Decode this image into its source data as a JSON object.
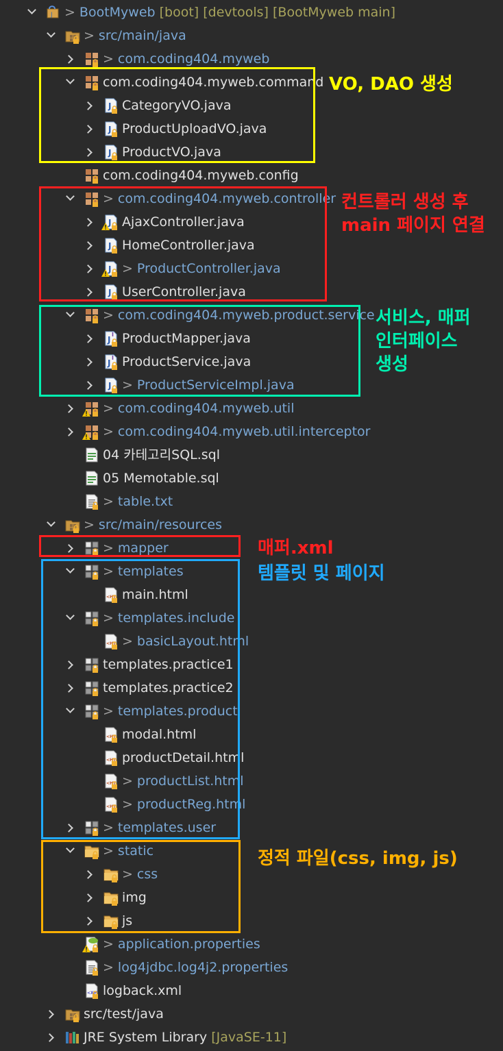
{
  "tree": [
    {
      "depth": 0,
      "chev": "e",
      "icon": "project",
      "dirty": true,
      "text": "BootMyweb",
      "suffix": " [boot] [devtools] [BootMyweb main]",
      "color": "blue",
      "x": 36
    },
    {
      "depth": 1,
      "chev": "e",
      "icon": "srcfolder",
      "dirty": true,
      "text": "src/main/java",
      "color": "blue"
    },
    {
      "depth": 2,
      "chev": "c",
      "icon": "package",
      "dirty": true,
      "text": "com.coding404.myweb",
      "color": "blue"
    },
    {
      "depth": 2,
      "chev": "e",
      "icon": "package",
      "text": "com.coding404.myweb.command",
      "color": "white"
    },
    {
      "depth": 3,
      "chev": "c",
      "icon": "java",
      "text": "CategoryVO.java",
      "color": "white"
    },
    {
      "depth": 3,
      "chev": "c",
      "icon": "java",
      "text": "ProductUploadVO.java",
      "color": "white"
    },
    {
      "depth": 3,
      "chev": "c",
      "icon": "java",
      "text": "ProductVO.java",
      "color": "white"
    },
    {
      "depth": 2,
      "chev": "",
      "icon": "package",
      "text": "com.coding404.myweb.config",
      "color": "white"
    },
    {
      "depth": 2,
      "chev": "e",
      "icon": "package",
      "dirty": true,
      "text": "com.coding404.myweb.controller",
      "color": "blue"
    },
    {
      "depth": 3,
      "chev": "c",
      "icon": "java",
      "warn": true,
      "text": "AjaxController.java",
      "color": "white"
    },
    {
      "depth": 3,
      "chev": "c",
      "icon": "java",
      "text": "HomeController.java",
      "color": "white"
    },
    {
      "depth": 3,
      "chev": "c",
      "icon": "java",
      "warn": true,
      "dirty": true,
      "text": "ProductController.java",
      "color": "blue"
    },
    {
      "depth": 3,
      "chev": "c",
      "icon": "java",
      "text": "UserController.java",
      "color": "white"
    },
    {
      "depth": 2,
      "chev": "e",
      "icon": "package",
      "dirty": true,
      "text": "com.coding404.myweb.product.service",
      "color": "blue"
    },
    {
      "depth": 3,
      "chev": "c",
      "icon": "interface",
      "text": "ProductMapper.java",
      "color": "white"
    },
    {
      "depth": 3,
      "chev": "c",
      "icon": "interface",
      "text": "ProductService.java",
      "color": "white"
    },
    {
      "depth": 3,
      "chev": "c",
      "icon": "java",
      "dirty": true,
      "text": "ProductServiceImpl.java",
      "color": "blue"
    },
    {
      "depth": 2,
      "chev": "c",
      "icon": "package",
      "warn": true,
      "dirty": true,
      "text": "com.coding404.myweb.util",
      "color": "blue"
    },
    {
      "depth": 2,
      "chev": "c",
      "icon": "package",
      "warn": true,
      "dirty": true,
      "text": "com.coding404.myweb.util.interceptor",
      "color": "blue"
    },
    {
      "depth": 2,
      "chev": "",
      "icon": "sql",
      "text": "04 카테고리SQL.sql",
      "color": "white"
    },
    {
      "depth": 2,
      "chev": "",
      "icon": "sql",
      "text": "05 Memotable.sql",
      "color": "white"
    },
    {
      "depth": 2,
      "chev": "",
      "icon": "text",
      "dirty": true,
      "text": "table.txt",
      "color": "blue"
    },
    {
      "depth": 1,
      "chev": "e",
      "icon": "srcfolder",
      "dirty": true,
      "text": "src/main/resources",
      "color": "blue"
    },
    {
      "depth": 2,
      "chev": "c",
      "icon": "folderpkg",
      "dirty": true,
      "text": "mapper",
      "color": "blue"
    },
    {
      "depth": 2,
      "chev": "e",
      "icon": "folderpkg",
      "dirty": true,
      "text": "templates",
      "color": "blue"
    },
    {
      "depth": 3,
      "chev": "",
      "icon": "html",
      "text": "main.html",
      "color": "white"
    },
    {
      "depth": 2,
      "chev": "e",
      "icon": "folderpkg",
      "dirty": true,
      "text": "templates.include",
      "color": "blue"
    },
    {
      "depth": 3,
      "chev": "",
      "icon": "html",
      "dirty": true,
      "text": "basicLayout.html",
      "color": "blue"
    },
    {
      "depth": 2,
      "chev": "c",
      "icon": "folderpkg",
      "text": "templates.practice1",
      "color": "white"
    },
    {
      "depth": 2,
      "chev": "c",
      "icon": "folderpkg",
      "text": "templates.practice2",
      "color": "white"
    },
    {
      "depth": 2,
      "chev": "e",
      "icon": "folderpkg",
      "dirty": true,
      "text": "templates.product",
      "color": "blue"
    },
    {
      "depth": 3,
      "chev": "",
      "icon": "html",
      "text": "modal.html",
      "color": "white"
    },
    {
      "depth": 3,
      "chev": "",
      "icon": "html",
      "text": "productDetail.html",
      "color": "white"
    },
    {
      "depth": 3,
      "chev": "",
      "icon": "html",
      "dirty": true,
      "text": "productList.html",
      "color": "blue"
    },
    {
      "depth": 3,
      "chev": "",
      "icon": "html",
      "dirty": true,
      "text": "productReg.html",
      "color": "blue"
    },
    {
      "depth": 2,
      "chev": "c",
      "icon": "folderpkg",
      "dirty": true,
      "text": "templates.user",
      "color": "blue"
    },
    {
      "depth": 2,
      "chev": "e",
      "icon": "folder",
      "dirty": true,
      "text": "static",
      "color": "blue"
    },
    {
      "depth": 3,
      "chev": "c",
      "icon": "folder",
      "dirty": true,
      "text": "css",
      "color": "blue"
    },
    {
      "depth": 3,
      "chev": "c",
      "icon": "folder",
      "text": "img",
      "color": "white"
    },
    {
      "depth": 3,
      "chev": "c",
      "icon": "folder",
      "text": "js",
      "color": "white"
    },
    {
      "depth": 2,
      "chev": "",
      "icon": "properties",
      "warn": true,
      "dirty": true,
      "text": "application.properties",
      "color": "blue"
    },
    {
      "depth": 2,
      "chev": "",
      "icon": "text",
      "dirty": true,
      "text": "log4jdbc.log4j2.properties",
      "color": "blue"
    },
    {
      "depth": 2,
      "chev": "",
      "icon": "xml",
      "text": "logback.xml",
      "color": "white"
    },
    {
      "depth": 1,
      "chev": "c",
      "icon": "srcfolder",
      "text": "src/test/java",
      "color": "white"
    },
    {
      "depth": 1,
      "chev": "c",
      "icon": "library",
      "text": "JRE System Library",
      "suffix": " [JavaSE-11]",
      "color": "white"
    }
  ],
  "notes": [
    {
      "id": "note-vo-dao",
      "lines": [
        "VO, DAO 생성"
      ],
      "color": "#ffff00"
    },
    {
      "id": "note-controller",
      "lines": [
        "컨트롤러 생성 후",
        "main 페이지 연결"
      ],
      "color": "#ff2020"
    },
    {
      "id": "note-service",
      "lines": [
        "서비스, 매퍼",
        "인터페이스",
        "생성"
      ],
      "color": "#00f0b0"
    },
    {
      "id": "note-mapper",
      "lines": [
        "매퍼.xml"
      ],
      "color": "#ff2020"
    },
    {
      "id": "note-templates",
      "lines": [
        "템플릿 및 페이지"
      ],
      "color": "#20aaff"
    },
    {
      "id": "note-static",
      "lines": [
        "정적 파일(css, img, js)"
      ],
      "color": "#ffb000"
    }
  ],
  "colors": {
    "background": "#2b2b2b",
    "yellow": "#ffff00",
    "red": "#ff2020",
    "teal": "#00f0b0",
    "blue": "#20aaff",
    "orange": "#ffb000"
  }
}
